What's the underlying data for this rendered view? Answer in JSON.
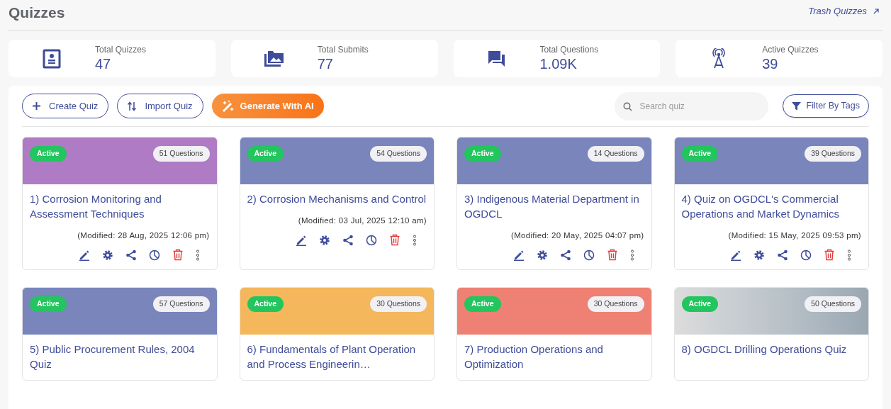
{
  "title": "Quizzes",
  "trash_link": "Trash Quizzes",
  "stats": [
    {
      "kind": "quizzes",
      "label": "Total Quizzes",
      "value": "47"
    },
    {
      "kind": "submits",
      "label": "Total Submits",
      "value": "77"
    },
    {
      "kind": "questions",
      "label": "Total Questions",
      "value": "1.09K"
    },
    {
      "kind": "active",
      "label": "Active Quizzes",
      "value": "39"
    }
  ],
  "toolbar": {
    "buttons": [
      {
        "kind": "create",
        "label": "Create Quiz"
      },
      {
        "kind": "import",
        "label": "Import Quiz"
      },
      {
        "kind": "ai",
        "label": "Generate With AI"
      }
    ],
    "search": {
      "placeholder": "Search quiz"
    },
    "filter": "Filter By Tags"
  },
  "quizzes": [
    {
      "kind": "color",
      "color": "#ae7bc4",
      "status": "Active",
      "questions": "51 Questions",
      "title": "1) Corrosion Monitoring and Assessment Techniques",
      "modified": "(Modified: 28 Aug, 2025 12:06 pm)"
    },
    {
      "kind": "color",
      "color": "#7985bb",
      "status": "Active",
      "questions": "54 Questions",
      "title": "2) Corrosion Mechanisms and Control",
      "modified": "(Modified: 03 Jul, 2025 12:10 am)"
    },
    {
      "kind": "color",
      "color": "#7985bb",
      "status": "Active",
      "questions": "14 Questions",
      "title": "3) Indigenous Material Department in OGDCL",
      "modified": "(Modified: 20 May, 2025 04:07 pm)"
    },
    {
      "kind": "color",
      "color": "#7985bb",
      "status": "Active",
      "questions": "39 Questions",
      "title": "4) Quiz on OGDCL's Commercial Operations and Market Dynamics",
      "modified": "(Modified: 15 May, 2025 09:53 pm)"
    },
    {
      "kind": "color",
      "color": "#7985bb",
      "status": "Active",
      "questions": "57 Questions",
      "title": "5) Public Procurement Rules, 2004 Quiz"
    },
    {
      "kind": "color",
      "color": "#f4b75c",
      "status": "Active",
      "questions": "30 Questions",
      "title": "6) Fundamentals of Plant Operation and Process Engineerin…"
    },
    {
      "kind": "color",
      "color": "#ee8173",
      "status": "Active",
      "questions": "30 Questions",
      "title": "7) Production Operations and Optimization"
    },
    {
      "kind": "photo",
      "status": "Active",
      "questions": "50 Questions",
      "title": "8) OGDCL Drilling Operations Quiz"
    }
  ]
}
